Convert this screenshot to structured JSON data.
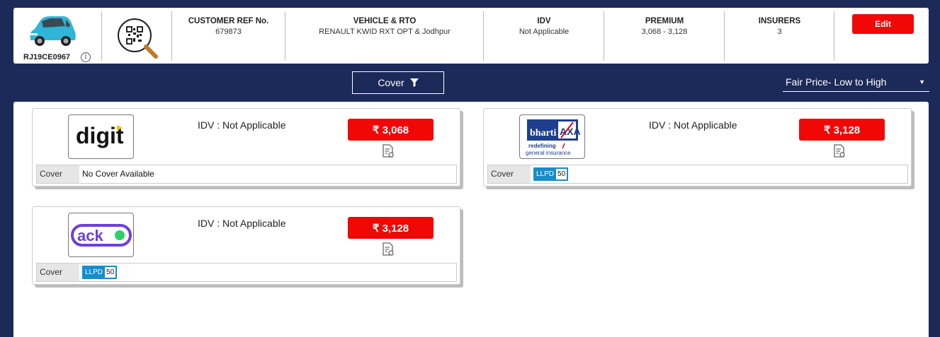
{
  "header": {
    "reg_no": "RJ19CE0967",
    "customer_ref": {
      "label": "CUSTOMER REF No.",
      "value": "679873"
    },
    "vehicle": {
      "label": "VEHICLE & RTO",
      "value": "RENAULT KWID RXT OPT & Jodhpur"
    },
    "idv": {
      "label": "IDV",
      "value": "Not Applicable"
    },
    "premium": {
      "label": "PREMIUM",
      "value": "3,068 - 3,128"
    },
    "insurers": {
      "label": "INSURERS",
      "value": "3"
    },
    "edit_label": "Edit"
  },
  "filters": {
    "cover_label": "Cover",
    "sort_selected": "Fair Price- Low to High"
  },
  "quotes": [
    {
      "insurer": "digit",
      "idv": "IDV : Not Applicable",
      "price": "₹ 3,068",
      "cover_label": "Cover",
      "cover_value": "No Cover Available"
    },
    {
      "insurer": "bharti AXA",
      "logo_tagline": "redefining / general insurance",
      "idv": "IDV : Not Applicable",
      "price": "₹ 3,128",
      "cover_label": "Cover",
      "chip_label": "LLPD",
      "chip_value": "50"
    },
    {
      "insurer": "acko",
      "idv": "IDV : Not Applicable",
      "price": "₹ 3,128",
      "cover_label": "Cover",
      "chip_label": "LLPD",
      "chip_value": "50"
    }
  ],
  "colors": {
    "navy": "#1c2a59",
    "red": "#f20707",
    "chip": "#1a8cc8",
    "acko": "#6d3fe0"
  }
}
